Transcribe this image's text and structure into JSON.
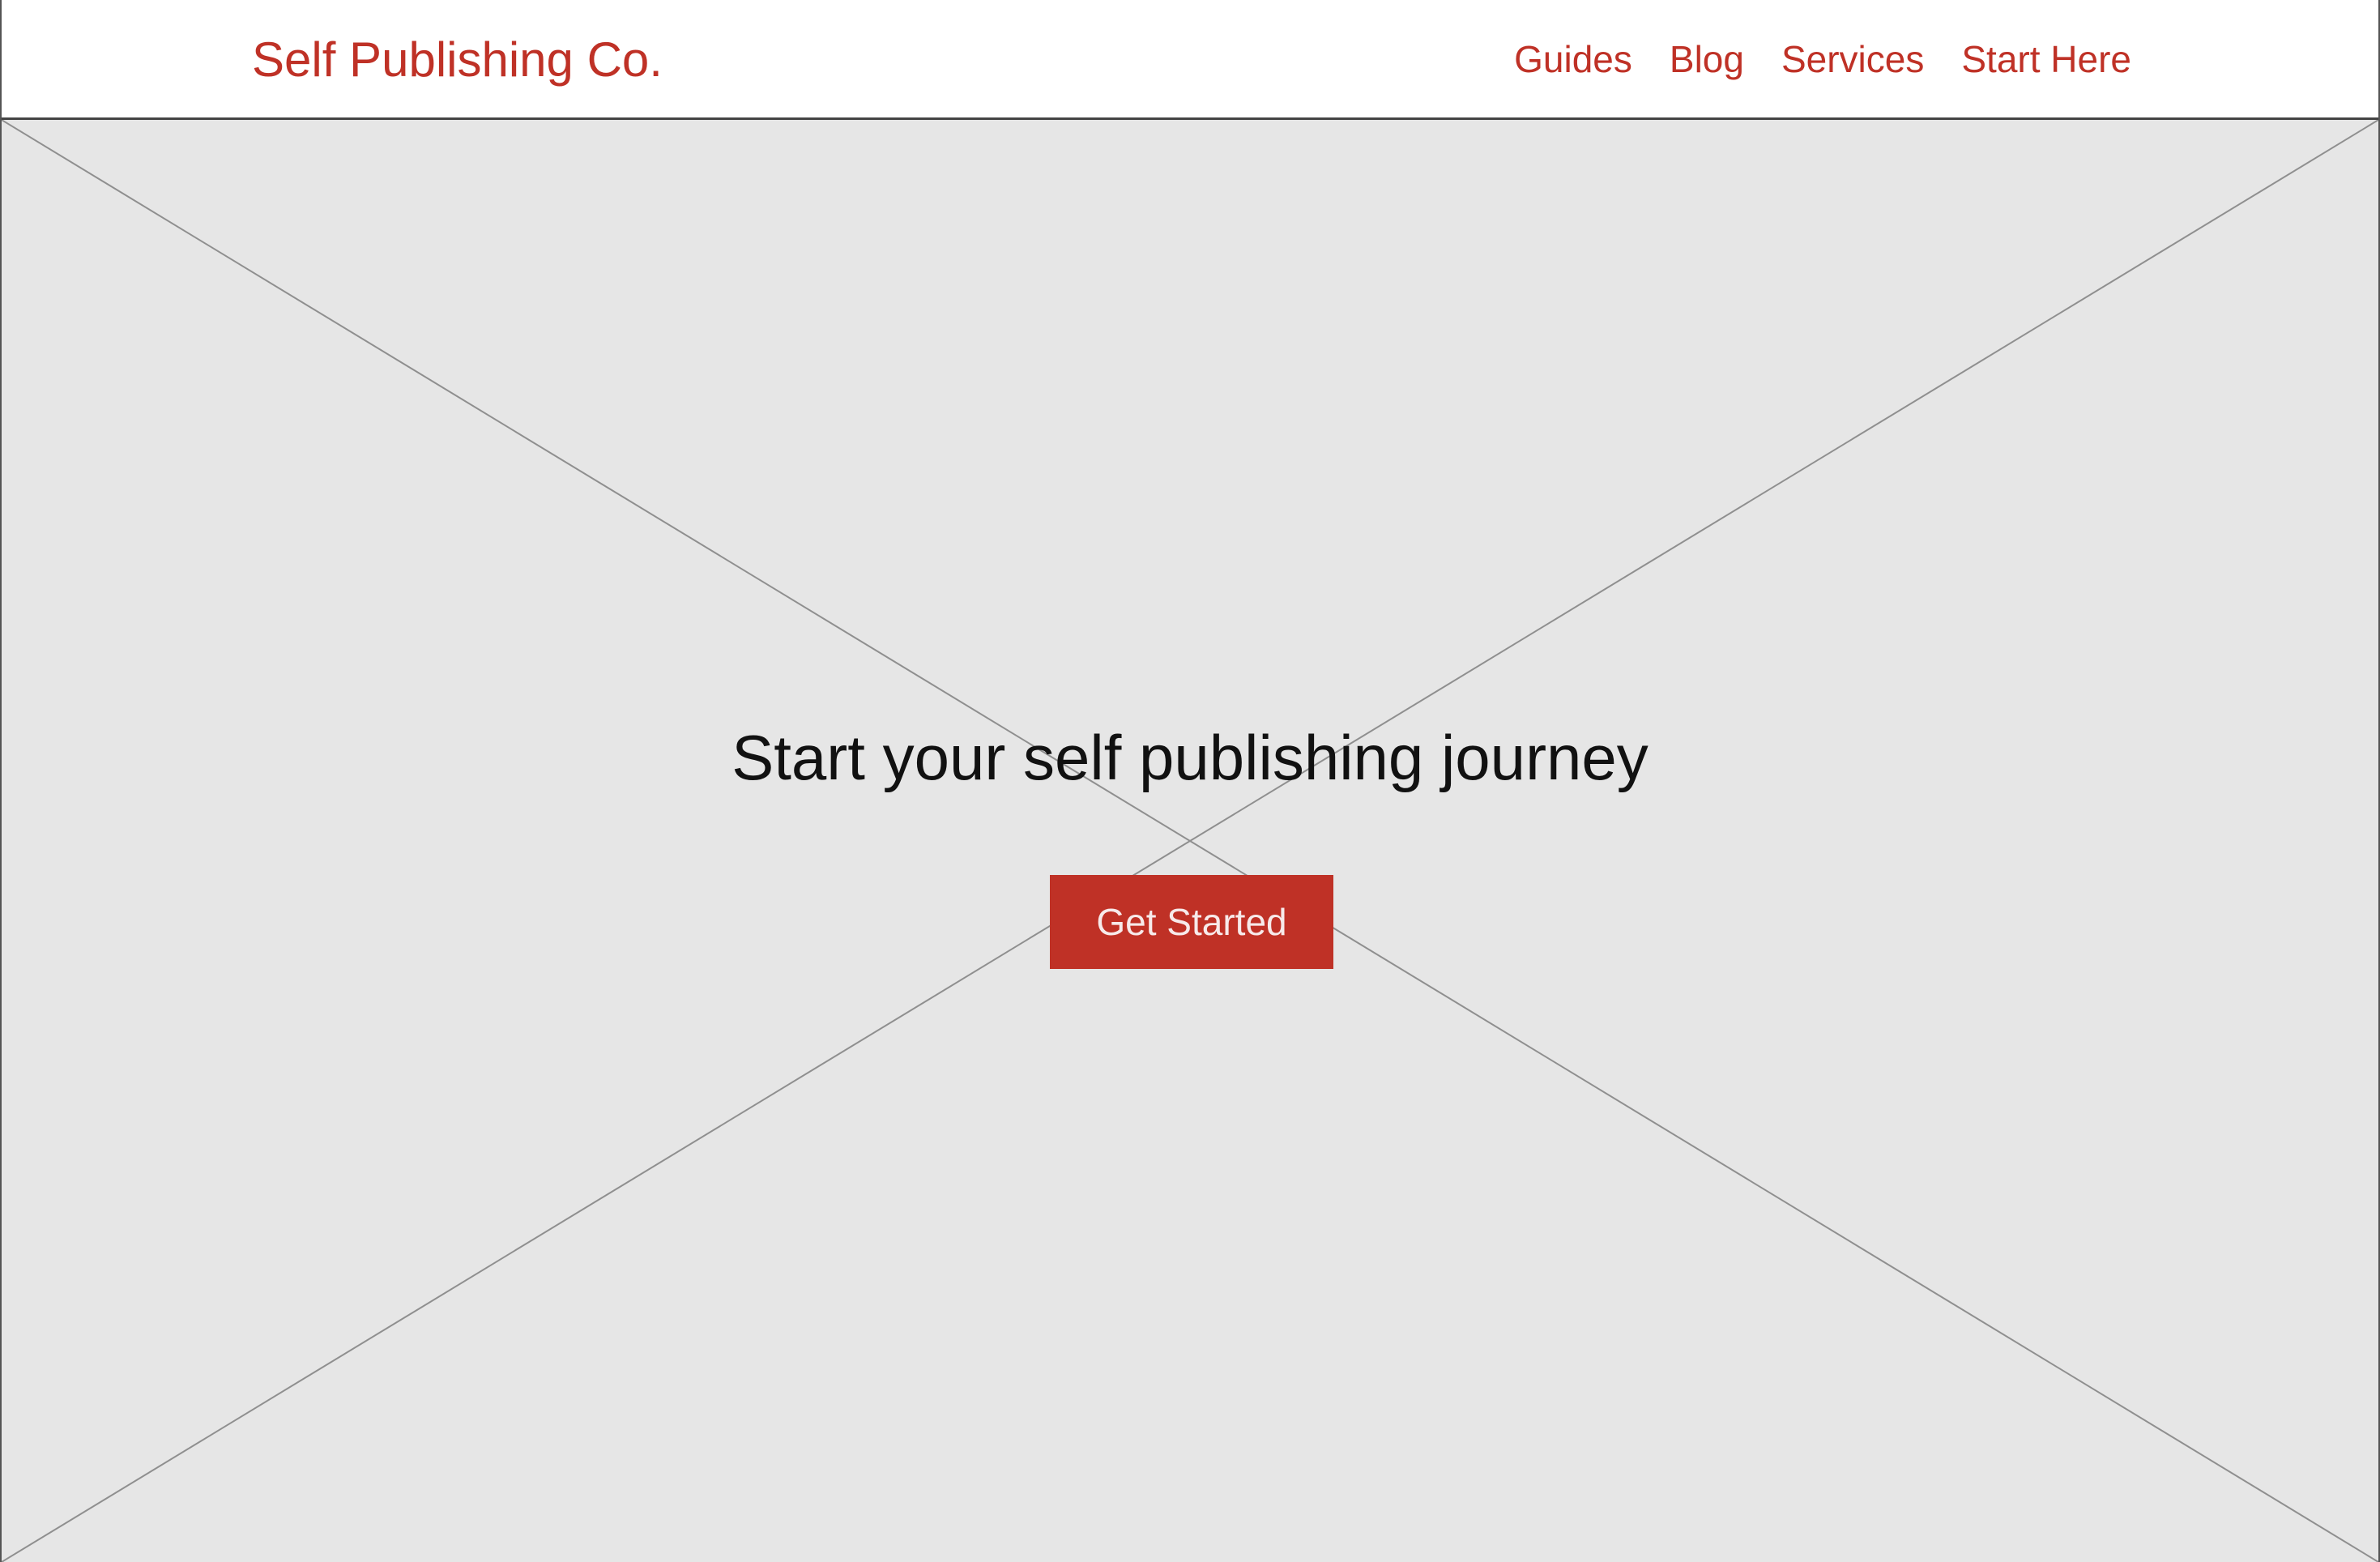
{
  "header": {
    "brand": "Self Publishing Co.",
    "nav": [
      {
        "label": "Guides"
      },
      {
        "label": "Blog"
      },
      {
        "label": "Services"
      },
      {
        "label": "Start Here"
      }
    ]
  },
  "hero": {
    "title": "Start your self publishing journey",
    "cta_label": "Get Started"
  },
  "colors": {
    "brand_red": "#bf3126",
    "hero_background": "#e6e6e6",
    "placeholder_lines": "#8f8f8f",
    "heading_text": "#111111"
  },
  "icons": {
    "hero_placeholder": "image-placeholder-icon"
  }
}
